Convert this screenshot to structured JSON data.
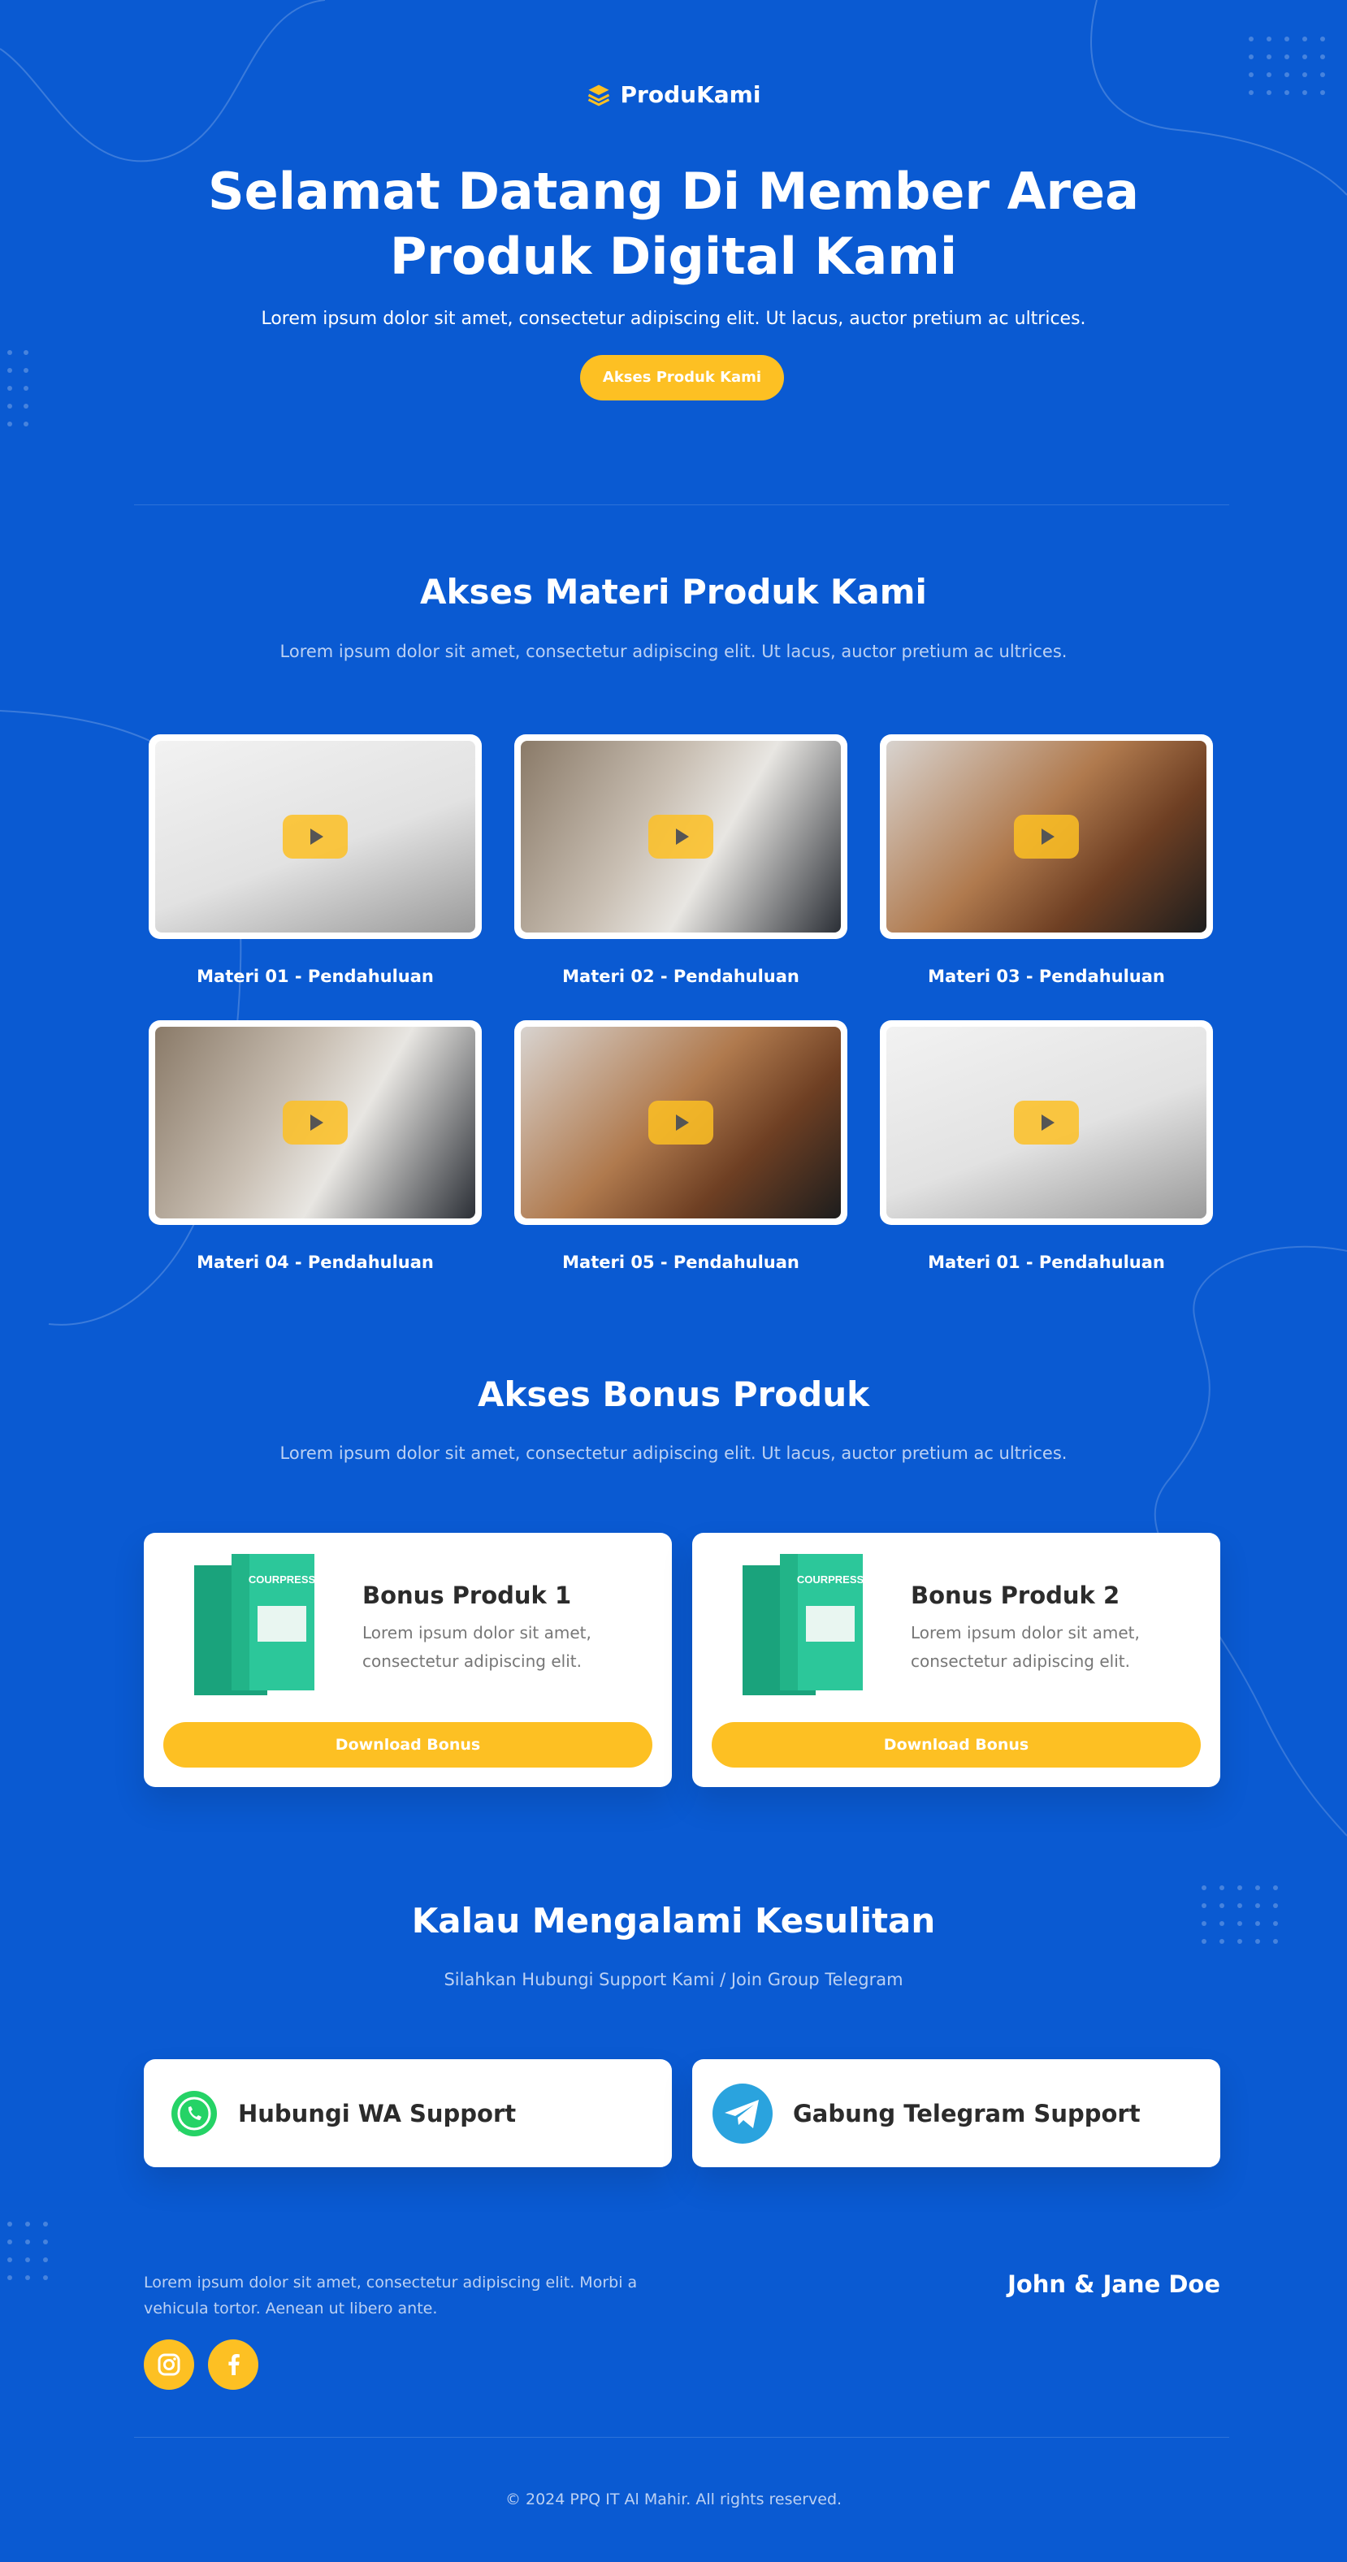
{
  "brand": {
    "name": "ProduKami"
  },
  "hero": {
    "title_line1": "Selamat Datang Di Member Area",
    "title_line2": "Produk Digital Kami",
    "subtitle": "Lorem ipsum dolor sit amet, consectetur adipiscing elit. Ut lacus, auctor pretium ac ultrices.",
    "button": "Akses Produk Kami"
  },
  "materials": {
    "title": "Akses Materi Produk Kami",
    "subtitle": "Lorem ipsum dolor sit amet, consectetur adipiscing elit. Ut lacus, auctor pretium ac ultrices.",
    "items": [
      {
        "label": "Materi 01 - Pendahuluan"
      },
      {
        "label": "Materi 02 - Pendahuluan"
      },
      {
        "label": "Materi 03 - Pendahuluan"
      },
      {
        "label": "Materi 04 - Pendahuluan"
      },
      {
        "label": "Materi 05 - Pendahuluan"
      },
      {
        "label": "Materi 01 - Pendahuluan"
      }
    ]
  },
  "bonus": {
    "title": "Akses Bonus Produk",
    "subtitle": "Lorem ipsum dolor sit amet, consectetur adipiscing elit. Ut lacus, auctor pretium ac ultrices.",
    "box_brand": "COURPRESS",
    "items": [
      {
        "title": "Bonus Produk 1",
        "desc": "Lorem ipsum dolor sit amet, consectetur adipiscing elit.",
        "button": "Download Bonus"
      },
      {
        "title": "Bonus Produk 2",
        "desc": "Lorem ipsum dolor sit amet, consectetur adipiscing elit.",
        "button": "Download Bonus"
      }
    ]
  },
  "support": {
    "title": "Kalau Mengalami Kesulitan",
    "subtitle": "Silahkan Hubungi Support Kami / Join Group Telegram",
    "whatsapp": "Hubungi WA Support",
    "telegram": "Gabung Telegram Support"
  },
  "footer": {
    "text": "Lorem ipsum dolor sit amet, consectetur adipiscing elit. Morbi a vehicula tortor. Aenean ut libero ante.",
    "name": "John & Jane Doe",
    "copyright": "© 2024 PPQ IT Al Mahir. All rights reserved."
  },
  "colors": {
    "background": "#0a5ad2",
    "accent": "#fdc023",
    "whatsapp": "#25d366",
    "telegram": "#2aa3de"
  }
}
